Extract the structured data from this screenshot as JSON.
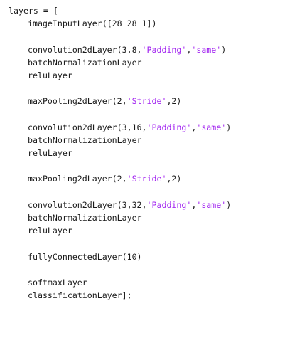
{
  "code_lines": [
    {
      "indent": false,
      "parts": [
        {
          "t": "layers = ["
        }
      ]
    },
    {
      "indent": true,
      "parts": [
        {
          "t": "imageInputLayer([28 28 1])"
        }
      ]
    },
    {
      "indent": false,
      "parts": []
    },
    {
      "indent": true,
      "parts": [
        {
          "t": "convolution2dLayer(3,8,"
        },
        {
          "t": "'Padding'",
          "s": true
        },
        {
          "t": ","
        },
        {
          "t": "'same'",
          "s": true
        },
        {
          "t": ")"
        }
      ]
    },
    {
      "indent": true,
      "parts": [
        {
          "t": "batchNormalizationLayer"
        }
      ]
    },
    {
      "indent": true,
      "parts": [
        {
          "t": "reluLayer"
        }
      ]
    },
    {
      "indent": false,
      "parts": []
    },
    {
      "indent": true,
      "parts": [
        {
          "t": "maxPooling2dLayer(2,"
        },
        {
          "t": "'Stride'",
          "s": true
        },
        {
          "t": ",2)"
        }
      ]
    },
    {
      "indent": false,
      "parts": []
    },
    {
      "indent": true,
      "parts": [
        {
          "t": "convolution2dLayer(3,16,"
        },
        {
          "t": "'Padding'",
          "s": true
        },
        {
          "t": ","
        },
        {
          "t": "'same'",
          "s": true
        },
        {
          "t": ")"
        }
      ]
    },
    {
      "indent": true,
      "parts": [
        {
          "t": "batchNormalizationLayer"
        }
      ]
    },
    {
      "indent": true,
      "parts": [
        {
          "t": "reluLayer"
        }
      ]
    },
    {
      "indent": false,
      "parts": []
    },
    {
      "indent": true,
      "parts": [
        {
          "t": "maxPooling2dLayer(2,"
        },
        {
          "t": "'Stride'",
          "s": true
        },
        {
          "t": ",2)"
        }
      ]
    },
    {
      "indent": false,
      "parts": []
    },
    {
      "indent": true,
      "parts": [
        {
          "t": "convolution2dLayer(3,32,"
        },
        {
          "t": "'Padding'",
          "s": true
        },
        {
          "t": ","
        },
        {
          "t": "'same'",
          "s": true
        },
        {
          "t": ")"
        }
      ]
    },
    {
      "indent": true,
      "parts": [
        {
          "t": "batchNormalizationLayer"
        }
      ]
    },
    {
      "indent": true,
      "parts": [
        {
          "t": "reluLayer"
        }
      ]
    },
    {
      "indent": false,
      "parts": []
    },
    {
      "indent": true,
      "parts": [
        {
          "t": "fullyConnectedLayer(10)"
        }
      ]
    },
    {
      "indent": false,
      "parts": []
    },
    {
      "indent": true,
      "parts": [
        {
          "t": "softmaxLayer"
        }
      ]
    },
    {
      "indent": true,
      "parts": [
        {
          "t": "classificationLayer];"
        }
      ]
    }
  ],
  "colors": {
    "text": "#1a1a1a",
    "string": "#a020f0",
    "background": "#ffffff"
  }
}
